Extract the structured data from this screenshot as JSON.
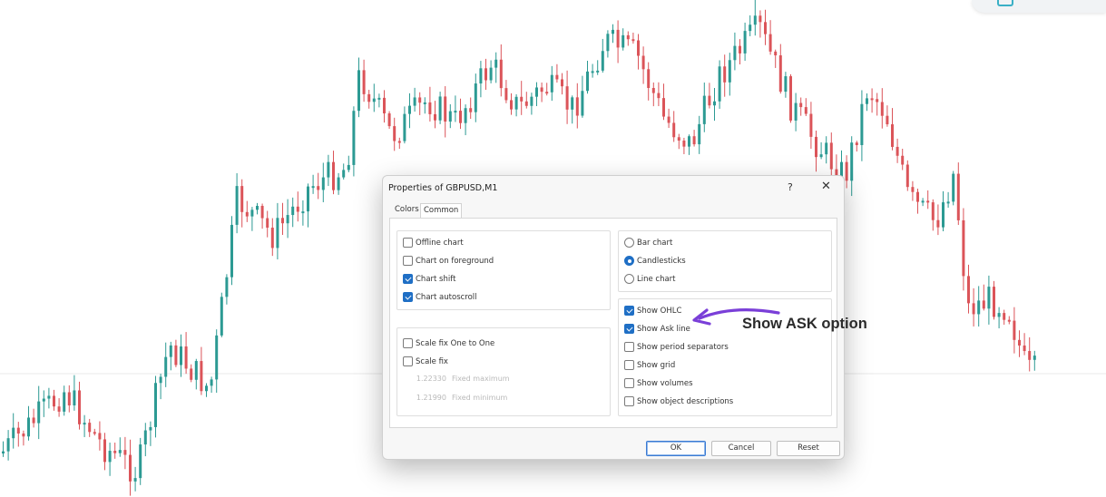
{
  "chart": {
    "up_color": "#2c9a93",
    "down_color": "#db5459",
    "guide_color": "#e8e8e8"
  },
  "dialog": {
    "title": "Properties of GBPUSD,M1",
    "help_label": "?",
    "close_label": "✕",
    "tabs": [
      {
        "label": "Colors",
        "selected": false
      },
      {
        "label": "Common",
        "selected": true
      }
    ],
    "left_options": [
      {
        "label": "Offline chart",
        "checked": false
      },
      {
        "label": "Chart on foreground",
        "checked": false
      },
      {
        "label": "Chart shift",
        "checked": true
      },
      {
        "label": "Chart autoscroll",
        "checked": true
      }
    ],
    "scale_options": [
      {
        "label": "Scale fix One to One",
        "checked": false
      },
      {
        "label": "Scale fix",
        "checked": false
      }
    ],
    "fixed_values": [
      {
        "value": "1.22330",
        "label": "Fixed maximum"
      },
      {
        "value": "1.21990",
        "label": "Fixed minimum"
      }
    ],
    "chart_types": [
      {
        "label": "Bar chart",
        "selected": false
      },
      {
        "label": "Candlesticks",
        "selected": true
      },
      {
        "label": "Line chart",
        "selected": false
      }
    ],
    "show_options": [
      {
        "label": "Show OHLC",
        "checked": true
      },
      {
        "label": "Show Ask line",
        "checked": true
      },
      {
        "label": "Show period separators",
        "checked": false
      },
      {
        "label": "Show grid",
        "checked": false
      },
      {
        "label": "Show volumes",
        "checked": false
      },
      {
        "label": "Show object descriptions",
        "checked": false
      }
    ],
    "buttons": {
      "ok": "OK",
      "cancel": "Cancel",
      "reset": "Reset"
    }
  },
  "annotation": {
    "text": "Show ASK option",
    "arrow_color": "#7a3fd8"
  }
}
